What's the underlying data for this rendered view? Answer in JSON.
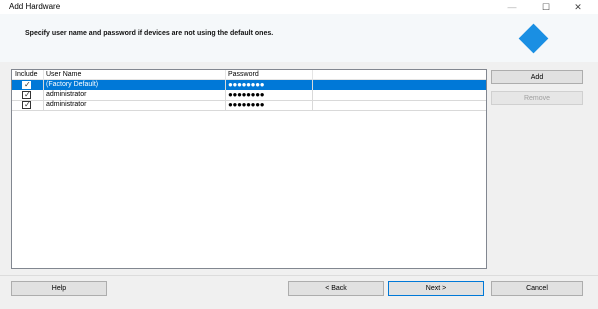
{
  "window": {
    "title": "Add Hardware",
    "minimize_glyph": "—",
    "maximize_glyph": "☐",
    "close_glyph": "✕"
  },
  "header": {
    "instruction": "Specify user name and password if devices are not using the default ones.",
    "logo_color": "#1a8fe3"
  },
  "credentials_table": {
    "columns": [
      "Include",
      "User Name",
      "Password"
    ],
    "rows": [
      {
        "include": true,
        "user": "(Factory Default)",
        "password": "●●●●●●●●",
        "selected": true
      },
      {
        "include": true,
        "user": "administrator",
        "password": "●●●●●●●●",
        "selected": false
      },
      {
        "include": true,
        "user": "administrator",
        "password": "●●●●●●●●",
        "selected": false
      }
    ]
  },
  "side_buttons": {
    "add_label": "Add",
    "remove_label": "Remove"
  },
  "footer": {
    "help_label": "Help",
    "back_label": "< Back",
    "next_label": "Next >",
    "cancel_label": "Cancel"
  },
  "colors": {
    "selection": "#0078d7",
    "accent": "#1a8fe3"
  }
}
